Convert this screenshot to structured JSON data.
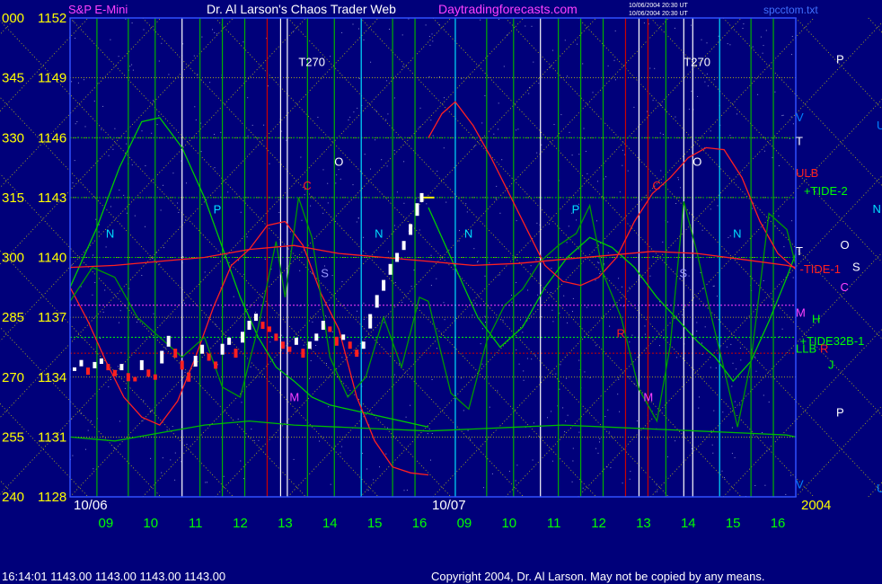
{
  "header": {
    "left": "S&P E-Mini",
    "center": "Dr. Al Larson's Chaos Trader Web",
    "site": "Daytradingforecasts.com",
    "stamp1": "10/06/2004 20:30 UT",
    "stamp2": "10/06/2004 20:30 UT",
    "file": "spcctom.txt"
  },
  "footer": {
    "quote": "16:14:01  1143.00 1143.00 1143.00 1143.00",
    "copyright": "Copyright 2004, Dr. Al Larson. May not be copied by any means."
  },
  "colors": {
    "background": "#00007a",
    "yellow": "#ffff00",
    "green_axis": "#00ff00",
    "grid_yellow": "#d8d800",
    "grid_green": "#00b000",
    "red": "#ff2020",
    "magenta": "#ff40ff",
    "cyan": "#00e0ff",
    "white": "#ffffff"
  },
  "chart_data": {
    "type": "line",
    "y_axis": {
      "ylim": [
        1128,
        1152
      ],
      "ticks": [
        {
          "angle": "000",
          "price": "1152",
          "value": 1152
        },
        {
          "angle": "345",
          "price": "1149",
          "value": 1149
        },
        {
          "angle": "330",
          "price": "1146",
          "value": 1146
        },
        {
          "angle": "315",
          "price": "1143",
          "value": 1143
        },
        {
          "angle": "300",
          "price": "1140",
          "value": 1140
        },
        {
          "angle": "285",
          "price": "1137",
          "value": 1137
        },
        {
          "angle": "270",
          "price": "1134",
          "value": 1134
        },
        {
          "angle": "255",
          "price": "1131",
          "value": 1131
        },
        {
          "angle": "240",
          "price": "1128",
          "value": 1128
        }
      ]
    },
    "x_axis": {
      "xlim": [
        8.2,
        24.4
      ],
      "day_labels": [
        {
          "label": "10/06",
          "x": 8.2
        },
        {
          "label": "10/07",
          "x": 16.2
        }
      ],
      "year_label": "2004",
      "ticks": [
        {
          "label": "09",
          "x": 9
        },
        {
          "label": "10",
          "x": 10
        },
        {
          "label": "11",
          "x": 11
        },
        {
          "label": "12",
          "x": 12
        },
        {
          "label": "13",
          "x": 13
        },
        {
          "label": "14",
          "x": 14
        },
        {
          "label": "15",
          "x": 15
        },
        {
          "label": "16",
          "x": 16
        },
        {
          "label": "09",
          "x": 17
        },
        {
          "label": "10",
          "x": 18
        },
        {
          "label": "11",
          "x": 19
        },
        {
          "label": "12",
          "x": 20
        },
        {
          "label": "13",
          "x": 21
        },
        {
          "label": "14",
          "x": 22
        },
        {
          "label": "15",
          "x": 23
        },
        {
          "label": "16",
          "x": 24
        }
      ]
    },
    "price_bars": [
      [
        8.3,
        1134.4
      ],
      [
        8.45,
        1134.7
      ],
      [
        8.6,
        1134.3
      ],
      [
        8.75,
        1134.6
      ],
      [
        8.9,
        1134.8
      ],
      [
        9.05,
        1134.5
      ],
      [
        9.2,
        1134.2
      ],
      [
        9.35,
        1134.5
      ],
      [
        9.5,
        1134.0
      ],
      [
        9.65,
        1133.9
      ],
      [
        9.8,
        1134.6
      ],
      [
        9.95,
        1134.2
      ],
      [
        10.1,
        1134.0
      ],
      [
        10.25,
        1135.0
      ],
      [
        10.4,
        1135.8
      ],
      [
        10.55,
        1135.2
      ],
      [
        10.7,
        1134.6
      ],
      [
        10.85,
        1134.0
      ],
      [
        11.0,
        1134.8
      ],
      [
        11.15,
        1135.4
      ],
      [
        11.3,
        1135.0
      ],
      [
        11.45,
        1134.6
      ],
      [
        11.6,
        1135.4
      ],
      [
        11.75,
        1135.8
      ],
      [
        11.9,
        1135.2
      ],
      [
        12.05,
        1136.0
      ],
      [
        12.2,
        1136.6
      ],
      [
        12.35,
        1137.0
      ],
      [
        12.5,
        1136.6
      ],
      [
        12.65,
        1136.4
      ],
      [
        12.8,
        1136.0
      ],
      [
        12.95,
        1135.6
      ],
      [
        13.1,
        1135.4
      ],
      [
        13.25,
        1135.8
      ],
      [
        13.4,
        1135.2
      ],
      [
        13.55,
        1135.6
      ],
      [
        13.7,
        1136.0
      ],
      [
        13.85,
        1136.6
      ],
      [
        14.0,
        1136.4
      ],
      [
        14.15,
        1135.8
      ],
      [
        14.3,
        1136.0
      ],
      [
        14.45,
        1135.6
      ],
      [
        14.6,
        1135.2
      ],
      [
        14.75,
        1135.6
      ],
      [
        14.9,
        1136.8
      ],
      [
        15.05,
        1137.8
      ],
      [
        15.2,
        1138.6
      ],
      [
        15.35,
        1139.4
      ],
      [
        15.5,
        1140.0
      ],
      [
        15.65,
        1140.6
      ],
      [
        15.8,
        1141.4
      ],
      [
        15.95,
        1142.4
      ],
      [
        16.05,
        1143.0
      ]
    ],
    "series": [
      {
        "name": "+TIDE-2",
        "color": "#00cc00",
        "x": [
          8.2,
          8.8,
          9.3,
          9.8,
          10.2,
          10.7,
          11.2,
          11.6,
          12.0,
          12.4,
          12.8,
          13.2,
          13.6,
          14.0,
          14.4,
          14.8,
          15.2,
          15.6,
          16.0,
          16.2
        ],
        "y": [
          1138.5,
          1141.5,
          1144.5,
          1146.8,
          1147.0,
          1145.5,
          1143.0,
          1140.5,
          1138.0,
          1136.0,
          1134.5,
          1133.8,
          1133.0,
          1132.6,
          1132.4,
          1132.2,
          1132.0,
          1131.8,
          1131.6,
          1131.5
        ]
      },
      {
        "name": "+TIDE-2",
        "color": "#00cc00",
        "x": [
          16.2,
          16.8,
          17.3,
          17.8,
          18.3,
          18.8,
          19.3,
          19.8,
          20.3,
          20.8,
          21.3,
          21.8,
          22.2,
          22.6,
          23.0,
          23.4,
          23.8,
          24.2,
          24.4
        ],
        "y": [
          1142.5,
          1139.5,
          1137.0,
          1135.5,
          1136.5,
          1138.5,
          1140.0,
          1141.0,
          1140.5,
          1139.5,
          1138.0,
          1136.8,
          1135.8,
          1135.0,
          1133.8,
          1134.8,
          1136.8,
          1139.0,
          1140.2
        ]
      },
      {
        "name": "-TIDE-1",
        "color": "#ff2020",
        "x": [
          8.2,
          8.6,
          9.0,
          9.4,
          9.8,
          10.2,
          10.6,
          11.0,
          11.4,
          11.8,
          12.2,
          12.6,
          13.0,
          13.4,
          13.8,
          14.2,
          14.6,
          15.0,
          15.4,
          15.8,
          16.2
        ],
        "y": [
          1138.5,
          1136.8,
          1134.8,
          1133.0,
          1132.0,
          1131.6,
          1132.8,
          1135.0,
          1137.5,
          1139.6,
          1140.4,
          1141.6,
          1141.8,
          1140.6,
          1138.2,
          1136.4,
          1133.0,
          1130.8,
          1129.5,
          1129.2,
          1129.1
        ]
      },
      {
        "name": "-TIDE-1",
        "color": "#ff2020",
        "x": [
          16.2,
          16.5,
          16.8,
          17.2,
          17.6,
          18.0,
          18.4,
          18.8,
          19.2,
          19.6,
          20.0,
          20.4,
          20.8,
          21.2,
          21.6,
          22.0,
          22.4,
          22.8,
          23.2,
          23.6,
          24.0,
          24.4
        ],
        "y": [
          1146.0,
          1147.2,
          1147.8,
          1146.6,
          1145.0,
          1143.2,
          1141.4,
          1139.6,
          1138.8,
          1138.6,
          1139.0,
          1140.0,
          1141.8,
          1143.2,
          1144.0,
          1145.0,
          1145.5,
          1145.4,
          1144.0,
          1141.8,
          1140.2,
          1139.4
        ]
      },
      {
        "name": "+TIDE32B-1",
        "color": "#009900",
        "x": [
          8.2,
          8.7,
          9.2,
          9.7,
          10.2,
          10.7,
          11.2,
          11.6,
          12.0,
          12.4,
          12.8,
          13.0,
          13.3,
          13.6,
          14.0,
          14.4,
          14.8,
          15.2,
          15.6,
          16.0,
          16.2
        ],
        "y": [
          1137.8,
          1139.5,
          1139.0,
          1137.0,
          1136.0,
          1135.0,
          1136.0,
          1133.5,
          1133.0,
          1136.5,
          1140.8,
          1138.0,
          1143.0,
          1141.0,
          1135.0,
          1133.0,
          1134.0,
          1137.0,
          1134.5,
          1138.0,
          1137.8
        ]
      },
      {
        "name": "+TIDE32B-1",
        "color": "#009900",
        "x": [
          16.2,
          16.7,
          17.1,
          17.5,
          17.9,
          18.3,
          18.7,
          19.1,
          19.5,
          19.8,
          20.1,
          20.5,
          20.9,
          21.3,
          21.6,
          21.9,
          22.2,
          22.5,
          22.8,
          23.1,
          23.4,
          23.8,
          24.2,
          24.4
        ],
        "y": [
          1137.8,
          1133.2,
          1132.4,
          1135.8,
          1137.6,
          1138.4,
          1139.8,
          1140.6,
          1141.2,
          1142.6,
          1139.2,
          1137.0,
          1133.4,
          1131.8,
          1135.6,
          1142.8,
          1140.2,
          1137.2,
          1134.4,
          1131.5,
          1134.8,
          1142.2,
          1141.4,
          1139.6
        ]
      },
      {
        "name": "LLB",
        "color": "#00bb00",
        "x": [
          8.2,
          9.2,
          10.2,
          11.2,
          12.2,
          13.2,
          14.2,
          15.2,
          16.2,
          17.2,
          18.2,
          19.2,
          20.2,
          21.2,
          22.2,
          23.2,
          24.2,
          24.4
        ],
        "y": [
          1131.0,
          1130.8,
          1131.2,
          1131.6,
          1131.8,
          1131.6,
          1131.5,
          1131.4,
          1131.3,
          1131.4,
          1131.5,
          1131.6,
          1131.5,
          1131.4,
          1131.3,
          1131.2,
          1131.1,
          1131.0
        ]
      },
      {
        "name": "ULB",
        "color": "#ff2020",
        "x": [
          8.2,
          9.2,
          10.2,
          11.2,
          12.2,
          13.2,
          14.2,
          15.2,
          16.2,
          17.2,
          18.2,
          19.2,
          20.2,
          21.2,
          22.2,
          23.2,
          24.2,
          24.4
        ],
        "y": [
          1139.5,
          1139.6,
          1139.8,
          1140.0,
          1140.4,
          1140.6,
          1140.2,
          1140.0,
          1139.8,
          1139.6,
          1139.7,
          1139.9,
          1140.1,
          1140.3,
          1140.2,
          1139.9,
          1139.6,
          1139.5
        ]
      }
    ],
    "vertical_lines": [
      {
        "x": 8.8,
        "color": "#00b000"
      },
      {
        "x": 9.5,
        "color": "#00b000"
      },
      {
        "x": 10.1,
        "color": "#00b000"
      },
      {
        "x": 10.7,
        "color": "#ffffff"
      },
      {
        "x": 11.1,
        "color": "#00b000"
      },
      {
        "x": 11.6,
        "color": "#00b000"
      },
      {
        "x": 12.1,
        "color": "#00b000"
      },
      {
        "x": 12.6,
        "color": "#cc0000"
      },
      {
        "x": 12.9,
        "color": "#ffffff"
      },
      {
        "x": 13.05,
        "color": "#ffffff"
      },
      {
        "x": 13.5,
        "color": "#00b000"
      },
      {
        "x": 14.1,
        "color": "#00b000"
      },
      {
        "x": 14.7,
        "color": "#00e0ff"
      },
      {
        "x": 15.4,
        "color": "#00b000"
      },
      {
        "x": 15.9,
        "color": "#00b000"
      },
      {
        "x": 16.8,
        "color": "#00e0ff"
      },
      {
        "x": 17.5,
        "color": "#00b000"
      },
      {
        "x": 18.1,
        "color": "#00b000"
      },
      {
        "x": 18.7,
        "color": "#ffffff"
      },
      {
        "x": 19.1,
        "color": "#00b000"
      },
      {
        "x": 19.6,
        "color": "#00b000"
      },
      {
        "x": 20.1,
        "color": "#00b000"
      },
      {
        "x": 20.6,
        "color": "#cc0000"
      },
      {
        "x": 20.9,
        "color": "#ffffff"
      },
      {
        "x": 21.1,
        "color": "#cc0000"
      },
      {
        "x": 21.5,
        "color": "#00b000"
      },
      {
        "x": 21.9,
        "color": "#ffffff"
      },
      {
        "x": 22.1,
        "color": "#ffffff"
      },
      {
        "x": 22.7,
        "color": "#00e0ff"
      },
      {
        "x": 23.4,
        "color": "#00b000"
      },
      {
        "x": 23.9,
        "color": "#00b000"
      }
    ],
    "horizontal_lines": [
      {
        "y": 1137.6,
        "color": "#ff40ff"
      },
      {
        "y": 1136.0,
        "color": "#00ff00"
      },
      {
        "y": 1135.2,
        "color": "#cc0000"
      },
      {
        "y": 1143.0,
        "color": "#00b000"
      },
      {
        "y": 1140.0,
        "color": "#00b000"
      },
      {
        "y": 1146.0,
        "color": "#00b000"
      }
    ],
    "chart_annotations": [
      {
        "text": "T270",
        "x": 13.3,
        "y": 1149.6,
        "color": "#ffffff"
      },
      {
        "text": "T270",
        "x": 21.9,
        "y": 1149.6,
        "color": "#ffffff"
      },
      {
        "text": "O",
        "x": 14.1,
        "y": 1144.6,
        "color": "#ffffff"
      },
      {
        "text": "O",
        "x": 22.1,
        "y": 1144.6,
        "color": "#ffffff"
      },
      {
        "text": "C",
        "x": 13.4,
        "y": 1143.4,
        "color": "#ff2020"
      },
      {
        "text": "C",
        "x": 21.2,
        "y": 1143.4,
        "color": "#ff2020"
      },
      {
        "text": "P",
        "x": 11.4,
        "y": 1142.2,
        "color": "#00e0ff"
      },
      {
        "text": "P",
        "x": 19.4,
        "y": 1142.2,
        "color": "#00e0ff"
      },
      {
        "text": "N",
        "x": 9.0,
        "y": 1141.0,
        "color": "#00e0ff"
      },
      {
        "text": "N",
        "x": 15.0,
        "y": 1141.0,
        "color": "#00e0ff"
      },
      {
        "text": "N",
        "x": 17.0,
        "y": 1141.0,
        "color": "#00e0ff"
      },
      {
        "text": "N",
        "x": 23.0,
        "y": 1141.0,
        "color": "#00e0ff"
      },
      {
        "text": "S",
        "x": 13.8,
        "y": 1139.0,
        "color": "#9999ff"
      },
      {
        "text": "S",
        "x": 21.8,
        "y": 1139.0,
        "color": "#9999ff"
      },
      {
        "text": "M",
        "x": 13.1,
        "y": 1132.8,
        "color": "#ff40ff"
      },
      {
        "text": "M",
        "x": 21.0,
        "y": 1132.8,
        "color": "#ff40ff"
      },
      {
        "text": "R",
        "x": 20.4,
        "y": 1136.0,
        "color": "#ff2020"
      }
    ],
    "right_labels": [
      {
        "text": "P",
        "y": 1149.9,
        "color": "#ffffff",
        "col": 2
      },
      {
        "text": "V",
        "y": 1147.0,
        "color": "#0080ff",
        "col": 1
      },
      {
        "text": "U",
        "y": 1146.6,
        "color": "#0080ff",
        "col": 3
      },
      {
        "text": "T",
        "y": 1145.8,
        "color": "#ffffff",
        "col": 1
      },
      {
        "text": "ULB",
        "y": 1144.2,
        "color": "#ff2020",
        "col": 1
      },
      {
        "text": "+TIDE-2",
        "y": 1143.3,
        "color": "#00ff00",
        "col": 1.2
      },
      {
        "text": "N",
        "y": 1142.4,
        "color": "#00e0ff",
        "col": 2.9
      },
      {
        "text": "T",
        "y": 1140.3,
        "color": "#ffffff",
        "col": 1
      },
      {
        "text": "O",
        "y": 1140.6,
        "color": "#ffffff",
        "col": 2.1
      },
      {
        "text": "-TIDE-1",
        "y": 1139.4,
        "color": "#ff2020",
        "col": 1.1
      },
      {
        "text": "S",
        "y": 1139.5,
        "color": "#ffffff",
        "col": 2.4
      },
      {
        "text": "C",
        "y": 1138.5,
        "color": "#ff40ff",
        "col": 2.1
      },
      {
        "text": "M",
        "y": 1137.2,
        "color": "#ff40ff",
        "col": 1
      },
      {
        "text": "H",
        "y": 1136.9,
        "color": "#00ff00",
        "col": 1.4
      },
      {
        "text": "+TIDE32B-1",
        "y": 1135.8,
        "color": "#00ff00",
        "col": 1.1
      },
      {
        "text": "LLB",
        "y": 1135.4,
        "color": "#00ff00",
        "col": 1
      },
      {
        "text": "R",
        "y": 1135.4,
        "color": "#ff2020",
        "col": 1.6
      },
      {
        "text": "J",
        "y": 1134.6,
        "color": "#00ff00",
        "col": 1.8
      },
      {
        "text": "P",
        "y": 1132.2,
        "color": "#ffffff",
        "col": 2
      },
      {
        "text": "V",
        "y": 1128.6,
        "color": "#0080ff",
        "col": 1
      },
      {
        "text": "U",
        "y": 1128.4,
        "color": "#0080ff",
        "col": 3
      }
    ]
  }
}
